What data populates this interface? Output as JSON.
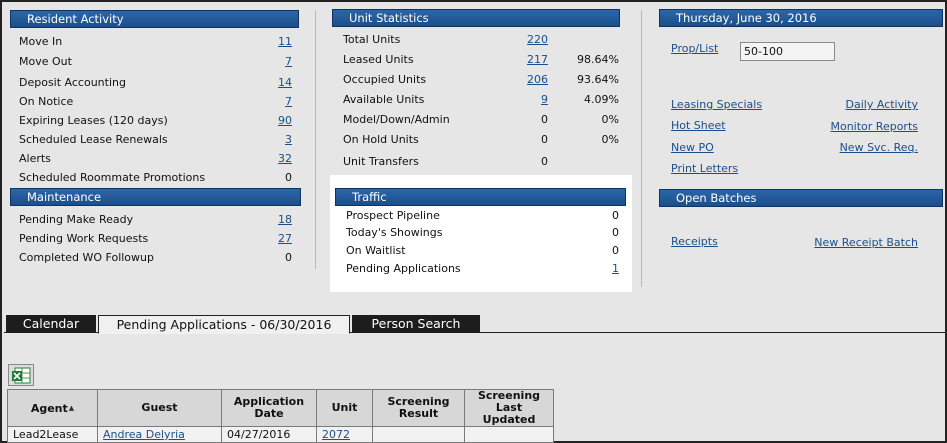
{
  "resident_activity": {
    "title": "Resident Activity",
    "rows": [
      {
        "label": "Move In",
        "value": "11",
        "link": true
      },
      {
        "label": "Move Out",
        "value": "7",
        "link": true
      },
      {
        "label": "Deposit Accounting",
        "value": "14",
        "link": true
      },
      {
        "label": "On Notice",
        "value": "7",
        "link": true
      },
      {
        "label": "Expiring Leases (120 days)",
        "value": "90",
        "link": true
      },
      {
        "label": "Scheduled Lease Renewals",
        "value": "3",
        "link": true
      },
      {
        "label": "Alerts",
        "value": "32",
        "link": true
      },
      {
        "label": "Scheduled Roommate Promotions",
        "value": "0",
        "link": false
      }
    ]
  },
  "maintenance": {
    "title": "Maintenance",
    "rows": [
      {
        "label": "Pending Make Ready",
        "value": "18",
        "link": true
      },
      {
        "label": "Pending Work Requests",
        "value": "27",
        "link": true
      },
      {
        "label": "Completed WO Followup",
        "value": "0",
        "link": false
      }
    ]
  },
  "unit_statistics": {
    "title": "Unit Statistics",
    "rows": [
      {
        "label": "Total Units",
        "value": "220",
        "link": true,
        "pct": ""
      },
      {
        "label": "Leased Units",
        "value": "217",
        "link": true,
        "pct": "98.64%"
      },
      {
        "label": "Occupied Units",
        "value": "206",
        "link": true,
        "pct": "93.64%"
      },
      {
        "label": "Available Units",
        "value": "9",
        "link": true,
        "pct": "4.09%"
      },
      {
        "label": "Model/Down/Admin",
        "value": "0",
        "link": false,
        "pct": "0%"
      },
      {
        "label": "On Hold Units",
        "value": "0",
        "link": false,
        "pct": "0%"
      },
      {
        "label": "Unit Transfers",
        "value": "0",
        "link": false,
        "pct": ""
      }
    ]
  },
  "traffic": {
    "title": "Traffic",
    "rows": [
      {
        "label": "Prospect Pipeline",
        "value": "0",
        "link": false
      },
      {
        "label": "Today's Showings",
        "value": "0",
        "link": false
      },
      {
        "label": "On Waitlist",
        "value": "0",
        "link": false
      },
      {
        "label": "Pending Applications",
        "value": "1",
        "link": true
      }
    ]
  },
  "date_panel": {
    "title": "Thursday, June 30, 2016",
    "prop_list_label": "Prop/List",
    "prop_list_value": "50-100",
    "links_left": [
      "Leasing Specials",
      "Hot Sheet",
      "New PO",
      "Print Letters"
    ],
    "links_right": [
      "Daily Activity",
      "Monitor Reports",
      "New Svc. Req."
    ]
  },
  "open_batches": {
    "title": "Open Batches",
    "receipts_label": "Receipts",
    "new_batch_label": "New Receipt Batch"
  },
  "tabs": [
    {
      "label": "Calendar",
      "active": false
    },
    {
      "label": "Pending Applications - 06/30/2016",
      "active": true
    },
    {
      "label": "Person Search",
      "active": false
    }
  ],
  "grid": {
    "columns": [
      "Agent",
      "Guest",
      "Application Date",
      "Unit",
      "Screening Result",
      "Screening Last Updated"
    ],
    "sort_indicator": "▲",
    "rows": [
      {
        "agent": "Lead2Lease",
        "guest": "Andrea Delyria",
        "date": "04/27/2016",
        "unit": "2072",
        "result": "",
        "updated": ""
      }
    ]
  },
  "icons": {
    "export": "excel-export-icon"
  }
}
